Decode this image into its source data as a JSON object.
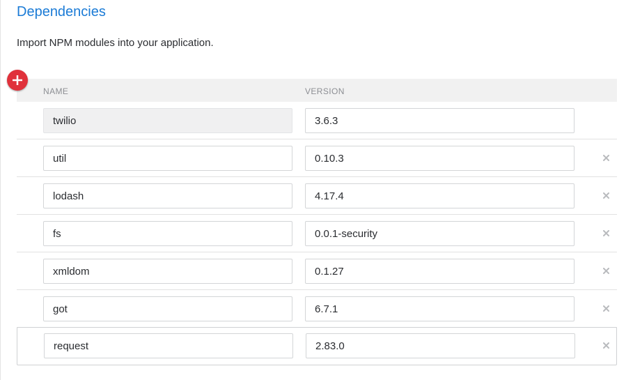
{
  "section": {
    "title": "Dependencies",
    "description": "Import NPM modules into your application."
  },
  "table": {
    "columns": {
      "name": "NAME",
      "version": "VERSION"
    },
    "rows": [
      {
        "name": "twilio",
        "version": "3.6.3",
        "locked": true
      },
      {
        "name": "util",
        "version": "0.10.3",
        "locked": false
      },
      {
        "name": "lodash",
        "version": "4.17.4",
        "locked": false
      },
      {
        "name": "fs",
        "version": "0.0.1-security",
        "locked": false
      },
      {
        "name": "xmldom",
        "version": "0.1.27",
        "locked": false
      },
      {
        "name": "got",
        "version": "6.7.1",
        "locked": false
      },
      {
        "name": "request",
        "version": "2.83.0",
        "locked": false
      }
    ]
  },
  "icons": {
    "add": "plus-icon",
    "remove": "close-icon"
  },
  "colors": {
    "accent": "#1b7bd6",
    "add_button": "#e0313b"
  }
}
